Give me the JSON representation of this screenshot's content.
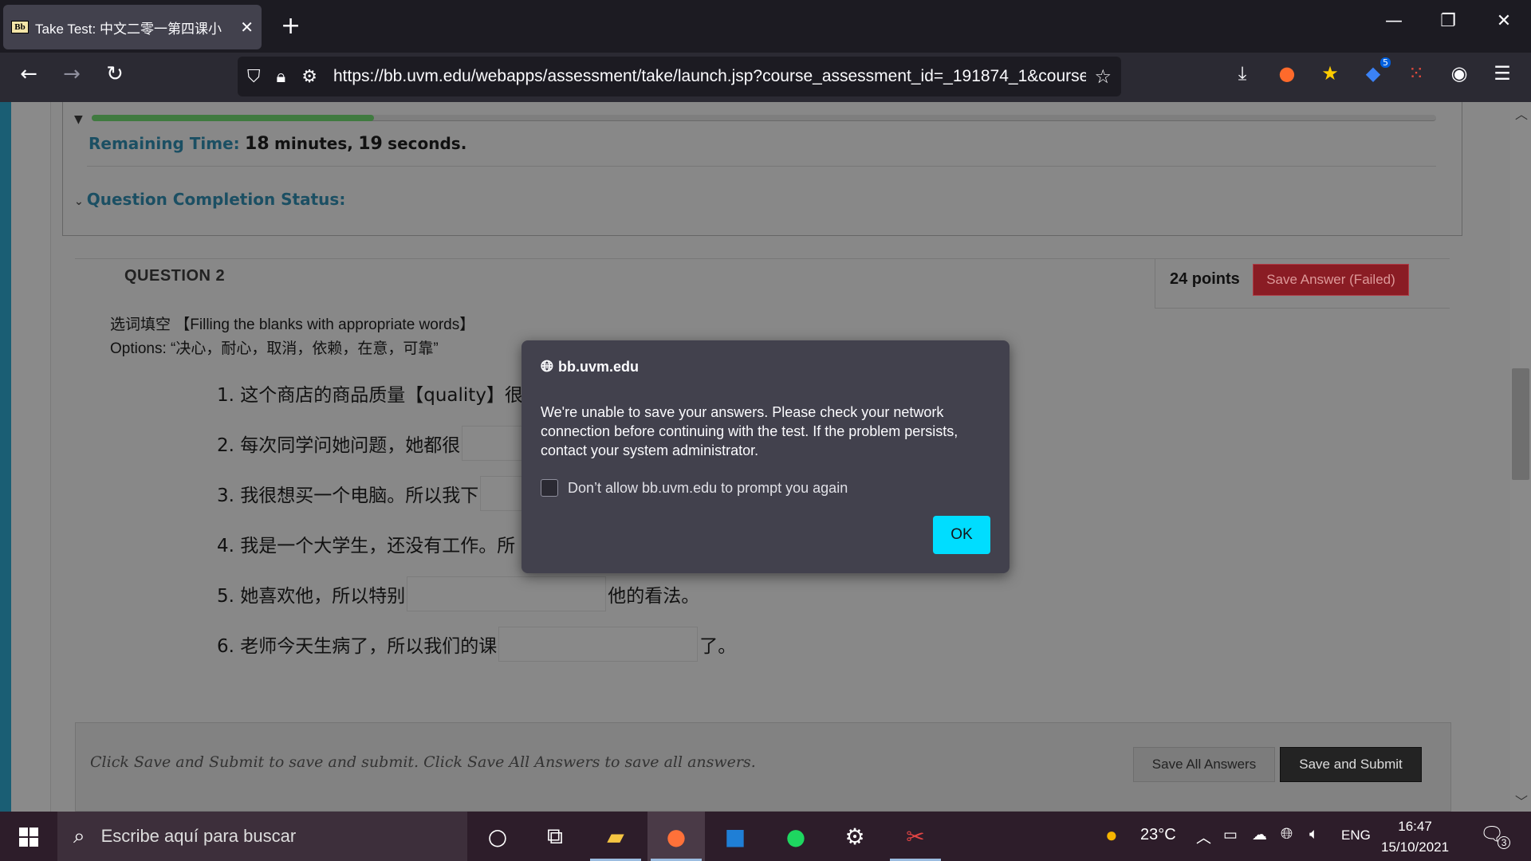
{
  "browser": {
    "tab_title": "Take Test: 中文二零一第四课小",
    "favicon_text": "Bb",
    "url": "https://bb.uvm.edu/webapps/assessment/take/launch.jsp?course_assessment_id=_191874_1&course_",
    "extension_badge": "5"
  },
  "timer": {
    "label": "Remaining Time:",
    "minutes": "18",
    "minutes_unit": "minutes,",
    "seconds": "19",
    "seconds_unit": "seconds.",
    "progress_fraction": 0.21
  },
  "completion_status_label": "Question Completion Status:",
  "question": {
    "title": "QUESTION 2",
    "points": "24 points",
    "save_status_button": "Save Answer (Failed)",
    "instruction_line1": "选词填空 【Filling the blanks with appropriate words】",
    "instruction_line2": "Options: “决心，耐心，取消，依赖，在意，可靠”",
    "items": [
      {
        "before": "1. 这个商店的商品质量【quality】很",
        "after": ""
      },
      {
        "before": "2. 每次同学问她问题，她都很",
        "after": ""
      },
      {
        "before": "3. 我很想买一个电脑。所以我下",
        "after": ""
      },
      {
        "before": "4. 我是一个大学生，还没有工作。所",
        "after": ""
      },
      {
        "before": "5. 她喜欢他，所以特别",
        "after": "他的看法。"
      },
      {
        "before": "6. 老师今天生病了，所以我们的课",
        "after": "了。"
      }
    ]
  },
  "footer": {
    "text": "Click Save and Submit to save and submit. Click Save All Answers to save all answers.",
    "save_all_label": "Save All Answers",
    "save_submit_label": "Save and Submit"
  },
  "dialog": {
    "origin": "bb.uvm.edu",
    "message": "We're unable to save your answers.  Please check your network connection before continuing with the test.  If the problem persists, contact your system administrator.",
    "checkbox_label": "Don’t allow bb.uvm.edu to prompt you again",
    "ok_label": "OK"
  },
  "taskbar": {
    "search_placeholder": "Escribe aquí para buscar",
    "temperature": "23°C",
    "language": "ENG",
    "time": "16:47",
    "date": "15/10/2021",
    "notification_count": "3"
  },
  "colors": {
    "dialog_ok": "#00ddff",
    "save_failed": "#8a1c24",
    "progress": "#3f7a3f"
  }
}
